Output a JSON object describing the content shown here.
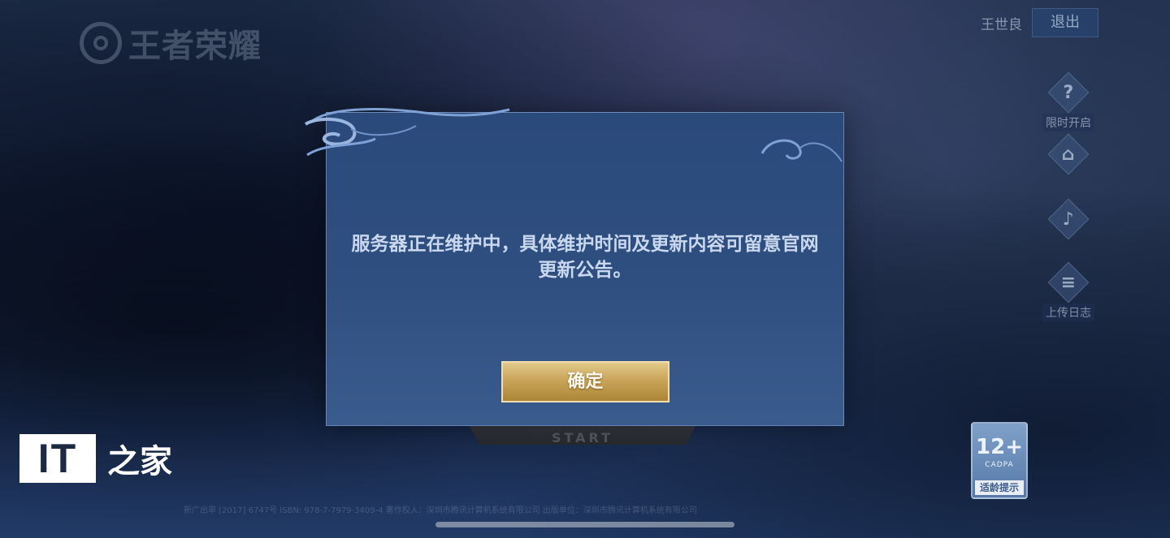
{
  "game_logo": {
    "text": "王者荣耀"
  },
  "user": {
    "name": "王世良",
    "logout_label": "退出"
  },
  "side_menu": [
    {
      "icon": "question-icon",
      "glyph": "?",
      "label": "限时开启"
    },
    {
      "icon": "gamepad-icon",
      "glyph": "⌂",
      "label": ""
    },
    {
      "icon": "speaker-icon",
      "glyph": "♪",
      "label": ""
    },
    {
      "icon": "clipboard-icon",
      "glyph": "≡",
      "label": "上传日志"
    }
  ],
  "dialog": {
    "message": "服务器正在维护中，具体维护时间及更新内容可留意官网更新公告。",
    "confirm_label": "确定"
  },
  "start_button": {
    "label": "START"
  },
  "age_rating": {
    "age": "12+",
    "org": "CADPA",
    "tip": "适龄提示"
  },
  "watermark": {
    "box_text": "IT",
    "text": "之家"
  },
  "footer": {
    "text": "新广出审 [2017] 6747号  ISBN: 978-7-7979-3409-4  著作权人：深圳市腾讯计算机系统有限公司  出版单位：深圳市腾讯计算机系统有限公司"
  }
}
